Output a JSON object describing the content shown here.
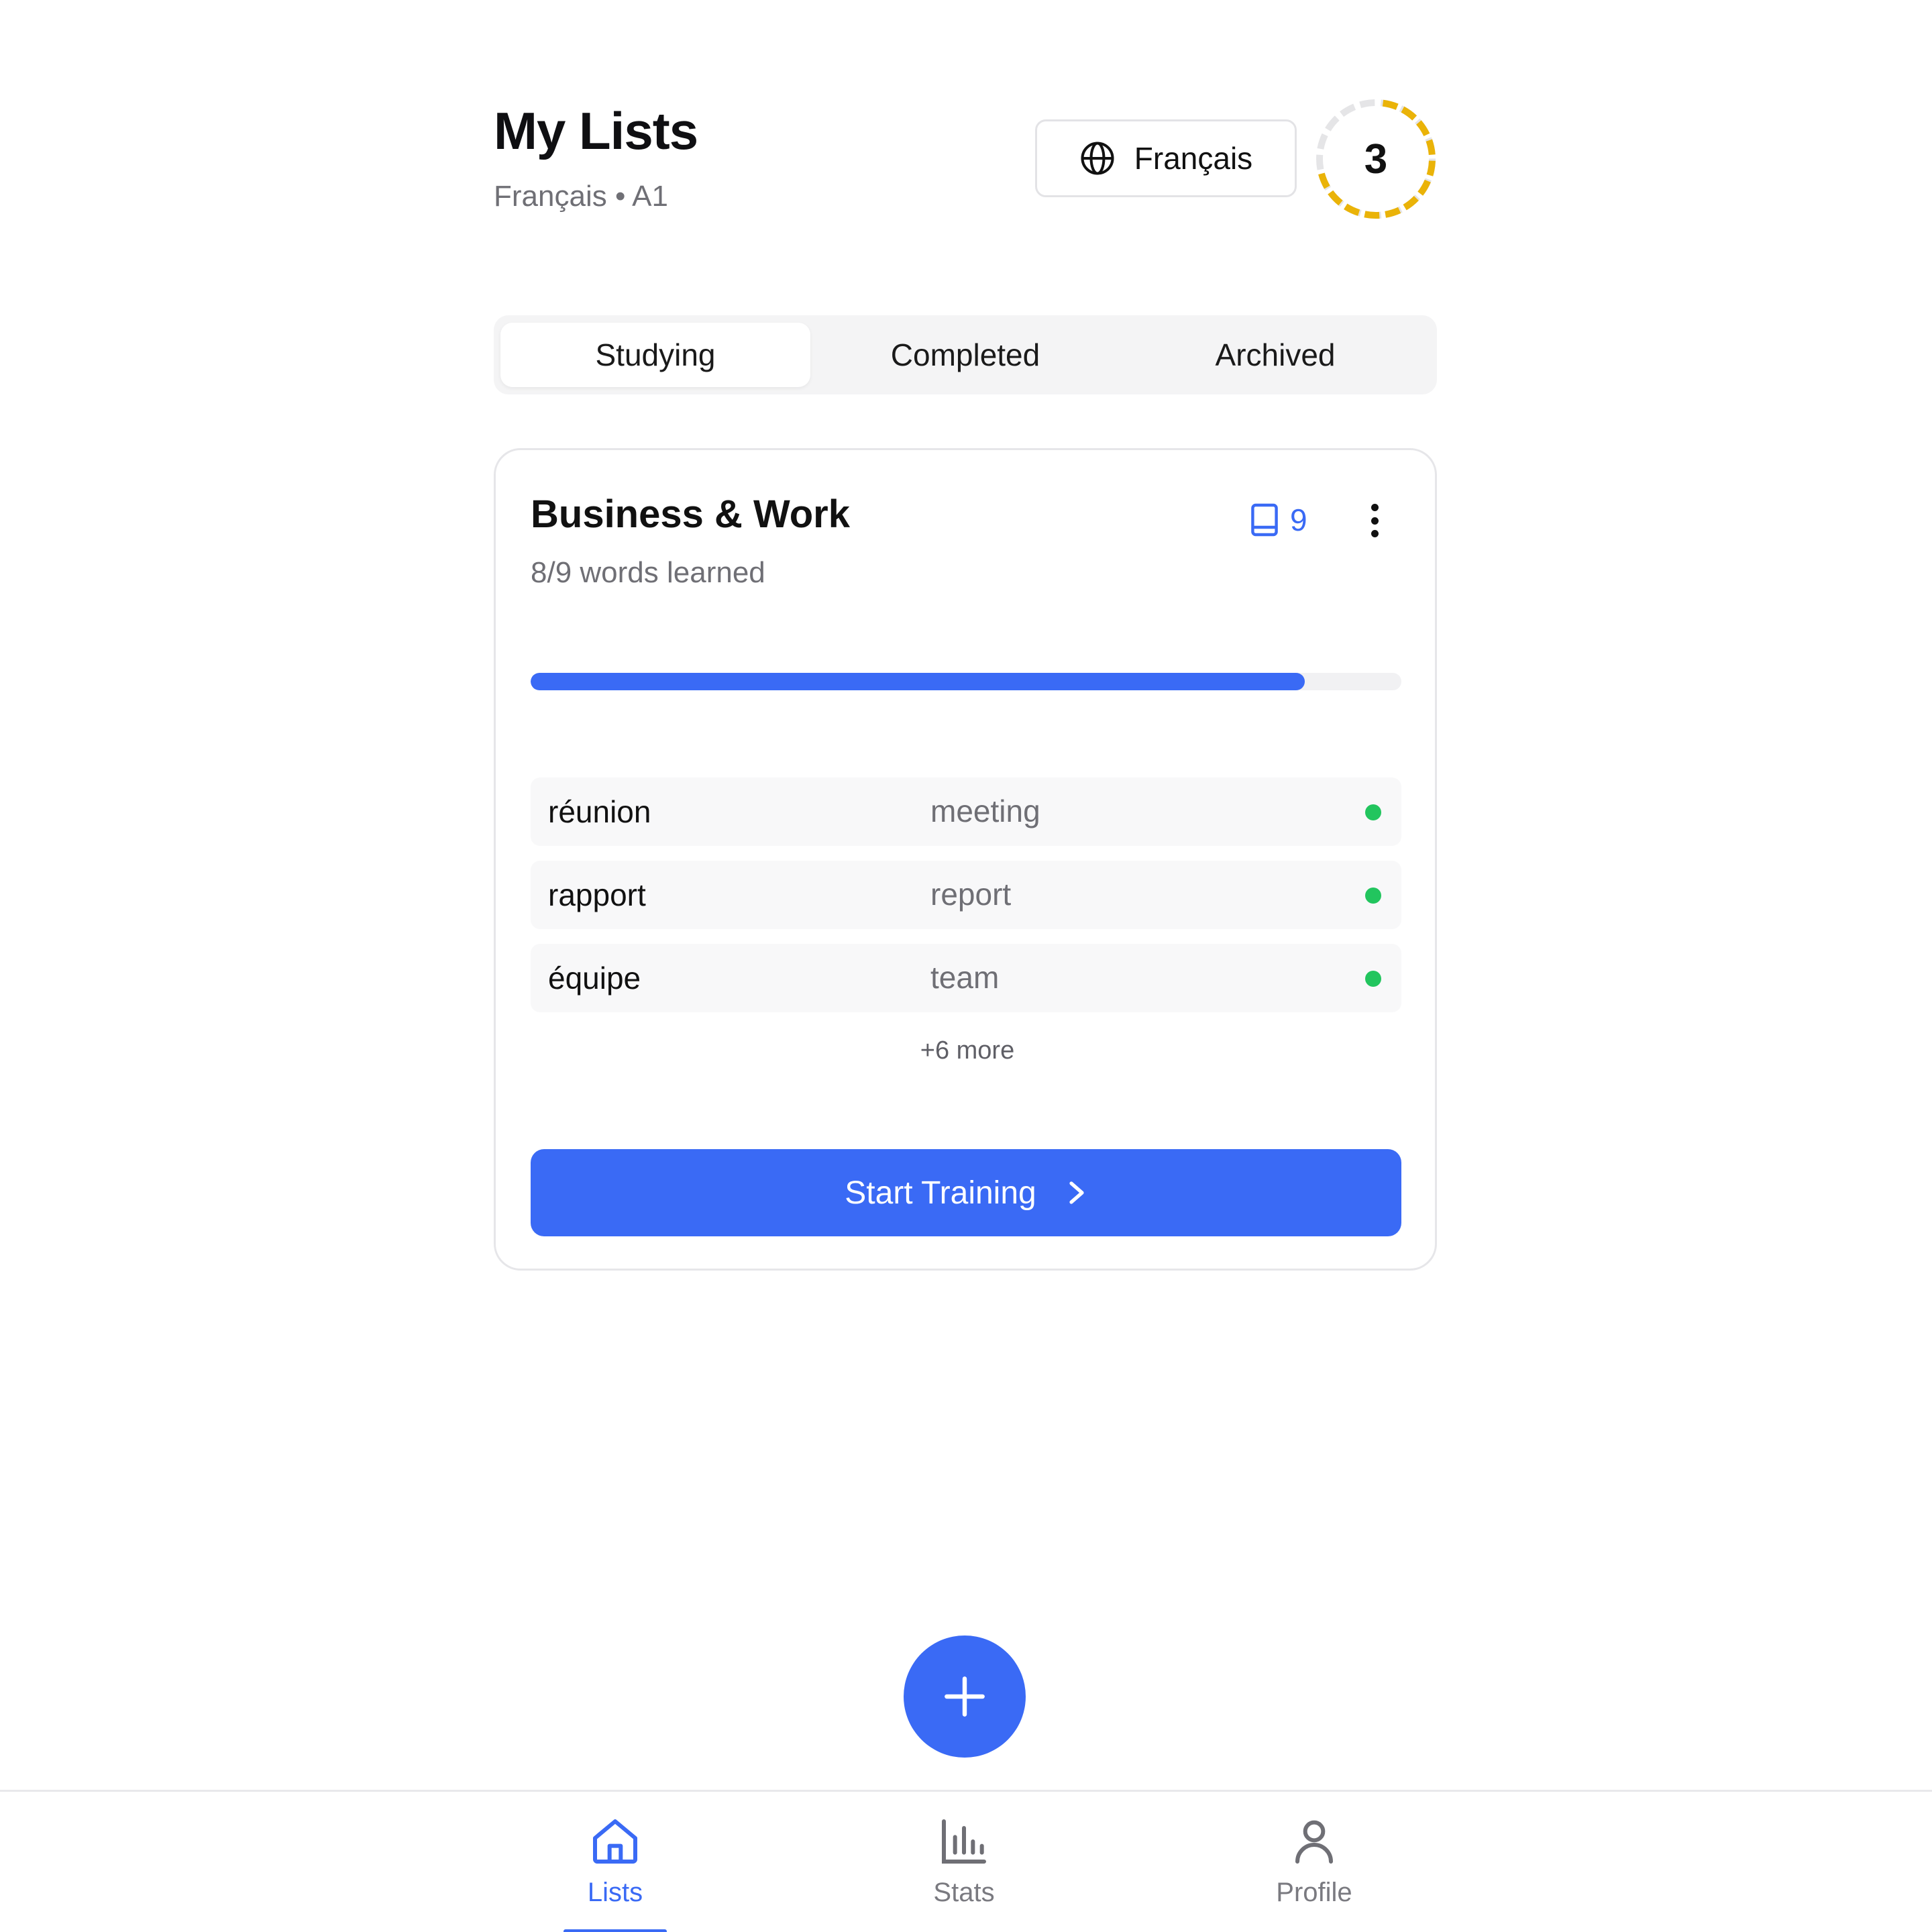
{
  "header": {
    "title": "My Lists",
    "subtitle": "Français • A1",
    "language_button": "Français",
    "streak_count": "3"
  },
  "tabs": [
    {
      "label": "Studying",
      "active": true
    },
    {
      "label": "Completed",
      "active": false
    },
    {
      "label": "Archived",
      "active": false
    }
  ],
  "list_card": {
    "title": "Business & Work",
    "subtitle": "8/9 words learned",
    "word_count": "9",
    "progress_fraction": 0.889,
    "words": [
      {
        "fr": "réunion",
        "en": "meeting",
        "status": "learned"
      },
      {
        "fr": "rapport",
        "en": "report",
        "status": "learned"
      },
      {
        "fr": "équipe",
        "en": "team",
        "status": "learned"
      }
    ],
    "more_label": "+6 more",
    "start_button": "Start Training"
  },
  "bottom_nav": [
    {
      "label": "Lists",
      "icon": "home-icon",
      "active": true
    },
    {
      "label": "Stats",
      "icon": "bar-chart-icon",
      "active": false
    },
    {
      "label": "Profile",
      "icon": "user-icon",
      "active": false
    }
  ],
  "colors": {
    "accent": "#3a6af5",
    "learned_dot": "#22c55e",
    "streak_ring": "#eab308",
    "streak_track": "#e5e5e7"
  }
}
